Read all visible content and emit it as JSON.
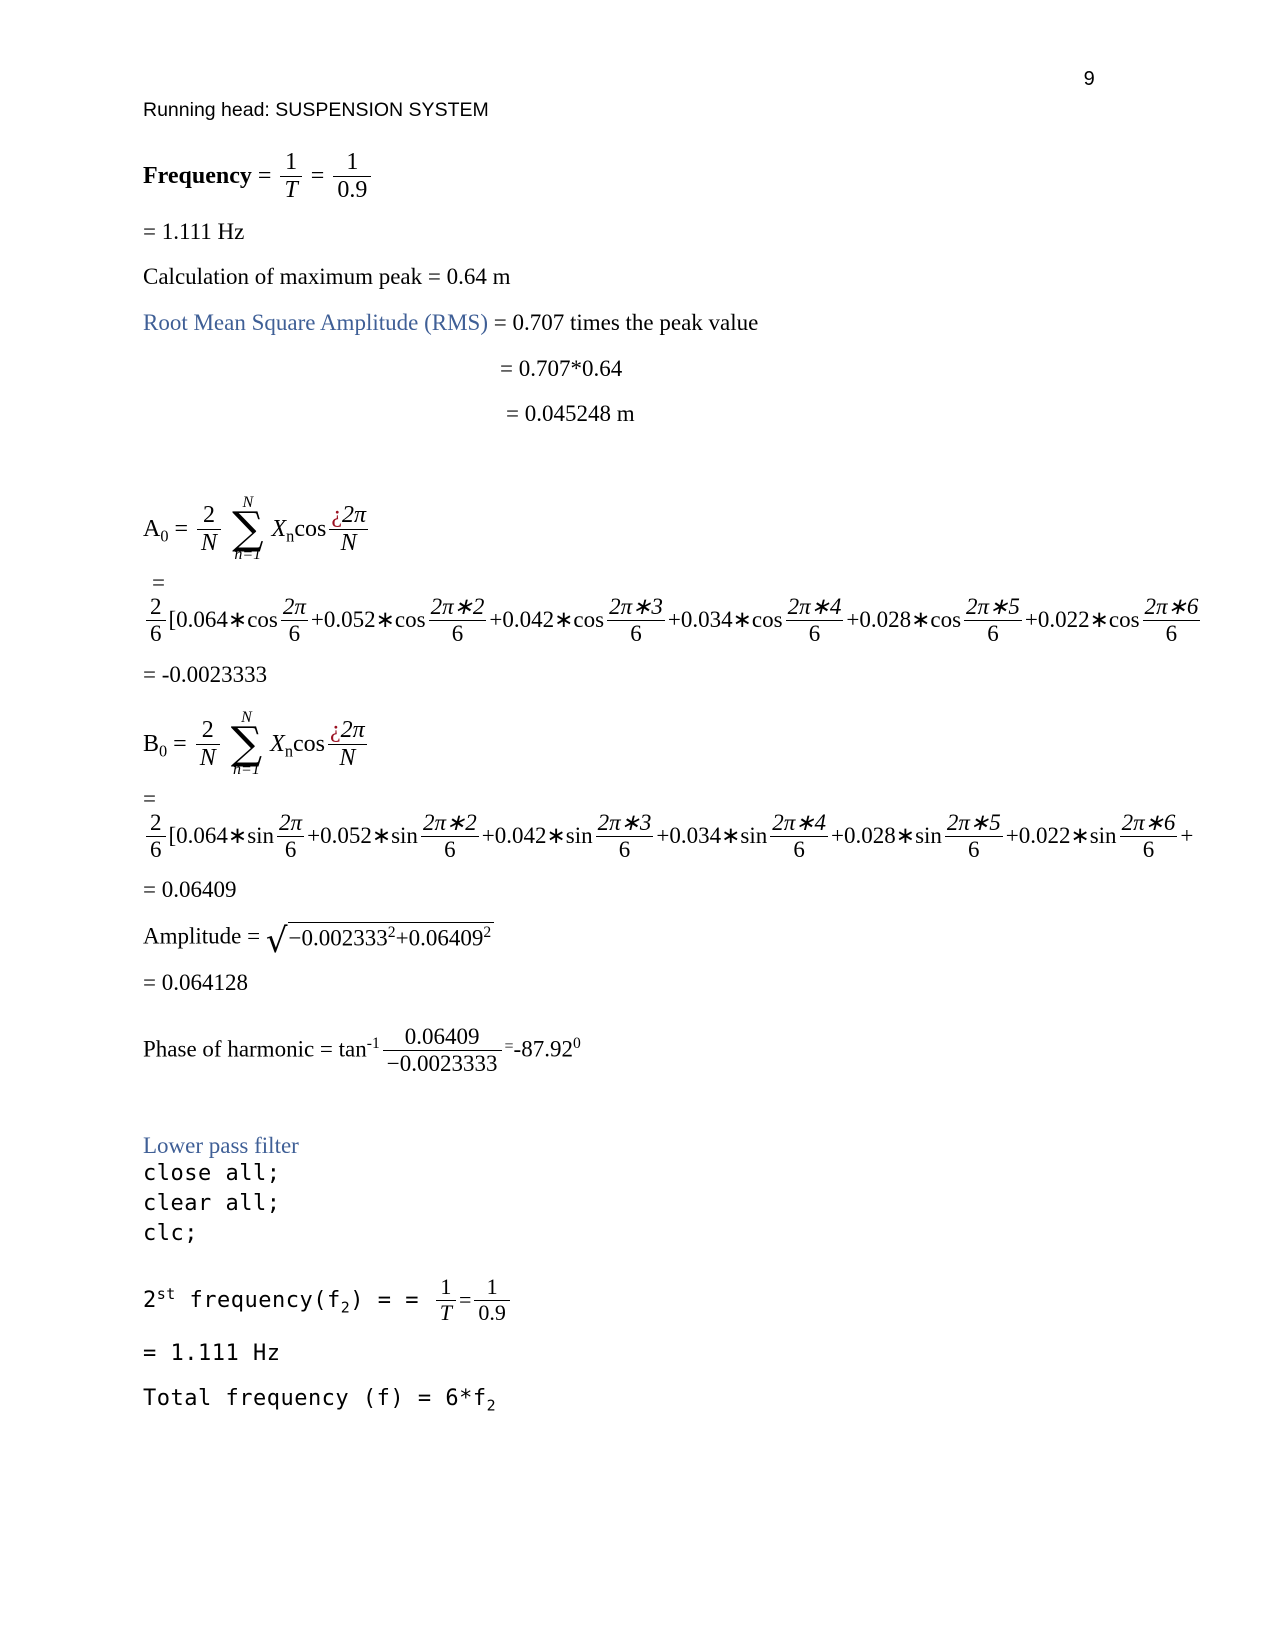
{
  "document": {
    "page_number": "9",
    "running_head": "Running head: SUSPENSION SYSTEM"
  },
  "frequency_block": {
    "label": "Frequency",
    "equals": "=",
    "frac1_num": "1",
    "frac1_den": "T",
    "eq2": "=",
    "frac2_num": "1",
    "frac2_den": "0.9",
    "result": " = 1.111 Hz"
  },
  "peak_block": {
    "max_peak_line": "Calculation of maximum peak = 0.64 m",
    "rms_label": "Root Mean Square Amplitude (RMS)",
    "rms_rest": " = 0.707 times the peak value",
    "rms_step1": "= 0.707*0.64",
    "rms_step2": " = 0.045248 m"
  },
  "a0_block": {
    "symbol": "A",
    "subscript": "0",
    "equals": "=",
    "coef_num": "2",
    "coef_den": "N",
    "sum_top": "N",
    "sum_bot": "n=1",
    "term_x": "X",
    "term_x_sub": "n",
    "trig": "cos",
    "arg_num_marker": "¿",
    "arg_num": "2π",
    "arg_den": "N",
    "equals_line": " =",
    "expansion_coef_num": "2",
    "expansion_coef_den": "6",
    "bracket": "[",
    "trig_fn": "cos",
    "terms": [
      {
        "coef": "0.064",
        "mult": "∗",
        "arg_num": "2π",
        "arg_den": "6",
        "plus": ""
      },
      {
        "coef": "0.052",
        "mult": "∗",
        "arg_num": "2π∗2",
        "arg_den": "6",
        "plus": "+"
      },
      {
        "coef": "0.042",
        "mult": "∗",
        "arg_num": "2π∗3",
        "arg_den": "6",
        "plus": "+"
      },
      {
        "coef": "0.034",
        "mult": "∗",
        "arg_num": "2π∗4",
        "arg_den": "6",
        "plus": "+"
      },
      {
        "coef": "0.028",
        "mult": "∗",
        "arg_num": "2π∗5",
        "arg_den": "6",
        "plus": "+"
      },
      {
        "coef": "0.022",
        "mult": "∗",
        "arg_num": "2π∗6",
        "arg_den": "6",
        "plus": "+"
      }
    ],
    "result": "= -0.0023333"
  },
  "b0_block": {
    "symbol": "B",
    "subscript": "0",
    "equals": "=",
    "coef_num": "2",
    "coef_den": "N",
    "sum_top": "N",
    "sum_bot": "n=1",
    "term_x": "X",
    "term_x_sub": "n",
    "trig": "cos",
    "arg_num_marker": "¿",
    "arg_num": "2π",
    "arg_den": "N",
    "equals_line": "=",
    "expansion_coef_num": "2",
    "expansion_coef_den": "6",
    "bracket": "[",
    "trig_fn": "sin",
    "terms": [
      {
        "coef": "0.064",
        "mult": "∗",
        "arg_num": "2π",
        "arg_den": "6",
        "plus": ""
      },
      {
        "coef": "0.052",
        "mult": "∗",
        "arg_num": "2π∗2",
        "arg_den": "6",
        "plus": "+"
      },
      {
        "coef": "0.042",
        "mult": "∗",
        "arg_num": "2π∗3",
        "arg_den": "6",
        "plus": "+"
      },
      {
        "coef": "0.034",
        "mult": "∗",
        "arg_num": "2π∗4",
        "arg_den": "6",
        "plus": "+"
      },
      {
        "coef": "0.028",
        "mult": "∗",
        "arg_num": "2π∗5",
        "arg_den": "6",
        "plus": "+"
      },
      {
        "coef": "0.022",
        "mult": "∗",
        "arg_num": "2π∗6",
        "arg_den": "6",
        "plus": "+"
      }
    ],
    "trailing_plus": "+",
    "result": "= 0.06409"
  },
  "amplitude_block": {
    "label": "Amplitude = ",
    "radicand_a": "−0.002333",
    "exp_a": "2",
    "plus": "+",
    "radicand_b": "0.06409",
    "exp_b": "2",
    "result": " = 0.064128"
  },
  "phase_block": {
    "label": "Phase of harmonic = tan",
    "exponent": "-1",
    "frac_num": "0.06409",
    "frac_den": "−0.0023333",
    "eq": "=",
    "value": "-87.92",
    "degree": "0"
  },
  "filter_block": {
    "heading": "Lower pass filter",
    "code_lines": [
      "close all;",
      "clear all;",
      "clc;"
    ],
    "freq_line_prefix": "2",
    "freq_line_sup": "st",
    "freq_line_mid": " frequency(f",
    "freq_line_sub": "2",
    "freq_line_after": ") =  = ",
    "frac1_num": "1",
    "frac1_den": "T",
    "frac_eq": "=",
    "frac2_num": "1",
    "frac2_den": "0.9",
    "result_line": " = 1.111 Hz",
    "total_prefix": "Total frequency (f) = 6*f",
    "total_sub": "2"
  },
  "colors": {
    "heading_blue": "#3f5f96",
    "marker_red": "#9b1122",
    "text_black": "#000000",
    "page_background": "#ffffff"
  }
}
